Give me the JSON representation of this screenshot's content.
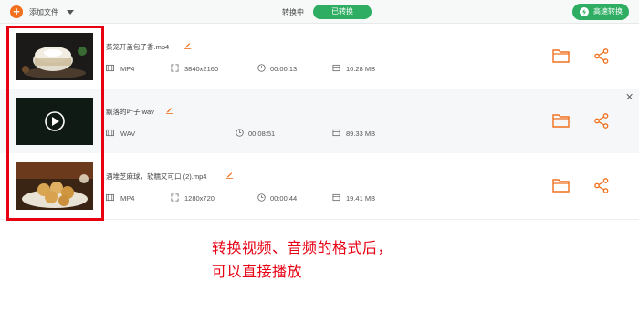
{
  "toolbar": {
    "add_file_label": "添加文件",
    "tab_converting": "转换中",
    "tab_converted": "已转换",
    "fast_convert_label": "高速转换"
  },
  "files": [
    {
      "name": "蒸笼开盖包子香.mp4",
      "format": "MP4",
      "resolution": "3840x2160",
      "duration": "00:00:13",
      "size": "10.28 MB"
    },
    {
      "name": "飘落的叶子.wav",
      "format": "WAV",
      "duration": "00:08:51",
      "size": "89.33 MB"
    },
    {
      "name": "酒堆芝麻球，软糯又可口 (2).mp4",
      "format": "MP4",
      "resolution": "1280x720",
      "duration": "00:00:44",
      "size": "19.41 MB"
    }
  ],
  "annotation": {
    "line1": "转换视频、音频的格式后，",
    "line2": "可以直接播放"
  },
  "colors": {
    "accent_orange": "#f0701e",
    "accent_green": "#2fae63",
    "annotation_red": "#e60012"
  },
  "icons": [
    "plus-icon",
    "chevron-down-icon",
    "bolt-icon",
    "edit-icon",
    "film-icon",
    "resolution-icon",
    "clock-icon",
    "size-icon",
    "folder-icon",
    "share-icon",
    "close-icon",
    "play-icon"
  ]
}
